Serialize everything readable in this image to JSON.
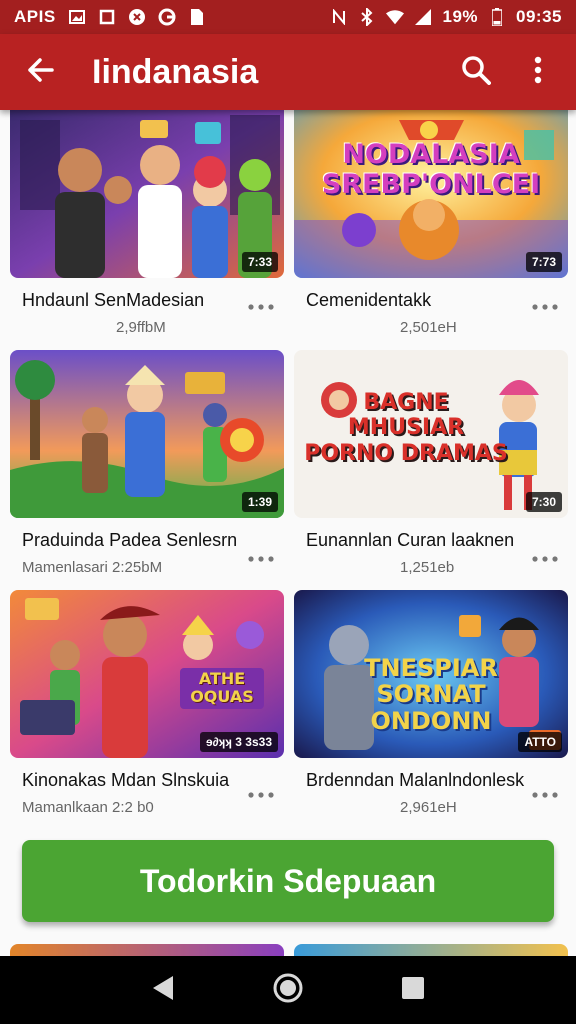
{
  "status_bar": {
    "carrier": "APIS",
    "battery": "19%",
    "time": "09:35",
    "icons": [
      "gallery-icon",
      "stop-icon",
      "app-icon",
      "google-icon",
      "file-icon",
      "nfc-icon",
      "bluetooth-icon",
      "wifi-icon",
      "signal-icon",
      "battery-icon"
    ]
  },
  "app_bar": {
    "title": "Iindanasia",
    "back_icon": "arrow-left-icon",
    "search_icon": "search-icon",
    "menu_icon": "more-vertical-icon"
  },
  "videos": [
    {
      "title": "Hndaunl SenMadesian",
      "subtitle": "2,9ffbM",
      "duration": "7:33",
      "thumb_text": ""
    },
    {
      "title": "Cemenidentakk",
      "subtitle": "2,501eH",
      "duration": "7:73",
      "thumb_text": "NODALASIA\nSREBP'ONLCEI"
    },
    {
      "title": "Praduinda Padea Senlesrn",
      "subtitle": "Mamenlasari 2:25bM",
      "duration": "1:39",
      "thumb_text": ""
    },
    {
      "title": "Eunannlan Curan laaknen",
      "subtitle": "1,251eb",
      "duration": "7:30",
      "thumb_text": "BAGNE\nMHUSIAR\nPORNO DRAMAS"
    },
    {
      "title": "Kinonakas Mdan Slnskuia",
      "subtitle": "Mamanlkaan 2:2 b0",
      "duration": "ɘ∂ʞʞ 3 3s33",
      "thumb_text": "ATHE\nOQUAS"
    },
    {
      "title": "Brdenndan Malanlndonlesk",
      "subtitle": "2,961eH",
      "duration": "ATTO",
      "thumb_text": "TNESPIAR\nSORNAT ONDONN"
    }
  ],
  "cta": {
    "label": "Todorkin Sdepuaan"
  },
  "colors": {
    "status_bar": "#a31f1f",
    "app_bar": "#b82222",
    "cta": "#4ba533"
  }
}
